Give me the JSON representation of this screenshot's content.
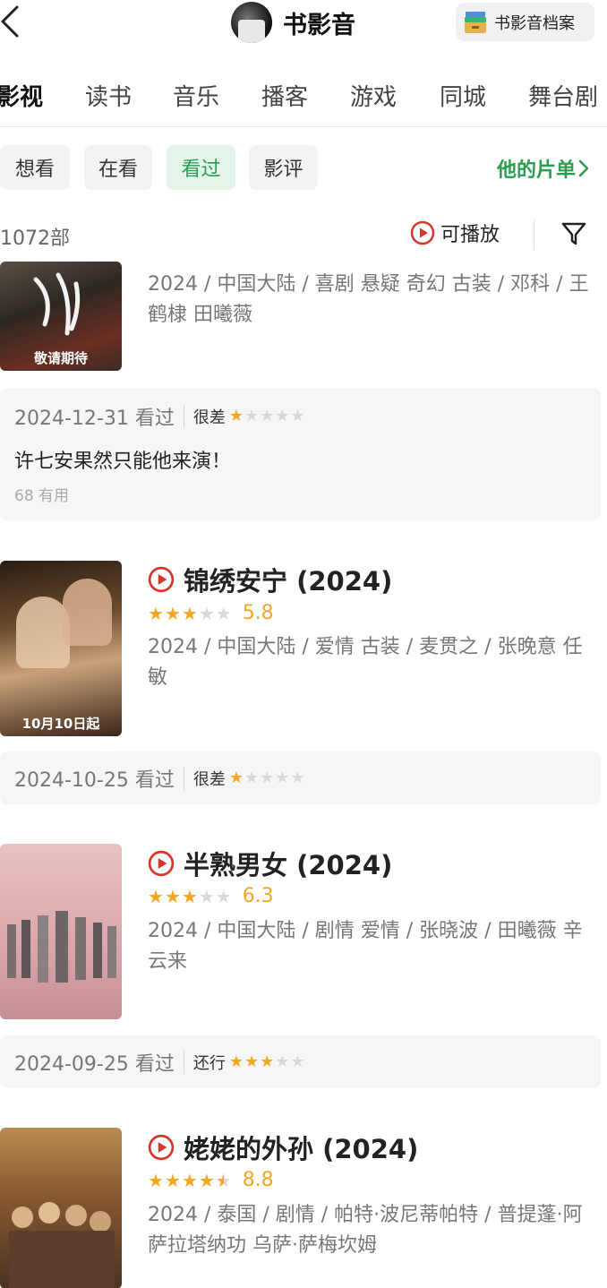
{
  "header": {
    "title": "书影音",
    "archive_label": "书影音档案"
  },
  "tabs": [
    {
      "label": "影视"
    },
    {
      "label": "读书"
    },
    {
      "label": "音乐"
    },
    {
      "label": "播客"
    },
    {
      "label": "游戏"
    },
    {
      "label": "同城"
    },
    {
      "label": "舞台剧"
    }
  ],
  "filters": [
    {
      "label": "想看"
    },
    {
      "label": "在看"
    },
    {
      "label": "看过"
    },
    {
      "label": "影评"
    }
  ],
  "my_lists_label": "他的片单",
  "count_label": "1072部",
  "playable_label": "可播放",
  "colors": {
    "accent_green": "#2a9d4e",
    "star_on": "#f4a623",
    "star_off": "#d8d8d8",
    "play_red": "#d9342b"
  },
  "items": [
    {
      "poster_caption": "敬请期待",
      "meta": "2024 / 中国大陆 / 喜剧 悬疑 奇幻 古装 / 邓科 / 王鹤棣 田曦薇",
      "review": {
        "date_label": "2024-12-31 看过",
        "rating_word": "很差",
        "rating_stars": 1,
        "text": "许七安果然只能他来演！",
        "useful": "68 有用"
      }
    },
    {
      "title": "锦绣安宁 (2024)",
      "stars": 3,
      "score": "5.8",
      "poster_caption": "10月10日起",
      "meta": "2024 / 中国大陆 / 爱情 古装 / 麦贯之 / 张晚意 任敏",
      "review": {
        "date_label": "2024-10-25 看过",
        "rating_word": "很差",
        "rating_stars": 1
      }
    },
    {
      "title": "半熟男女 (2024)",
      "stars": 3,
      "score": "6.3",
      "meta": "2024 / 中国大陆 / 剧情 爱情 / 张晓波 / 田曦薇 辛云来",
      "review": {
        "date_label": "2024-09-25 看过",
        "rating_word": "还行",
        "rating_stars": 3
      }
    },
    {
      "title": "姥姥的外孙 (2024)",
      "stars": 4.5,
      "score": "8.8",
      "meta": "2024 / 泰国 / 剧情 / 帕特·波尼蒂帕特 / 普提蓬·阿萨拉塔纳功 乌萨·萨梅坎姆"
    }
  ]
}
